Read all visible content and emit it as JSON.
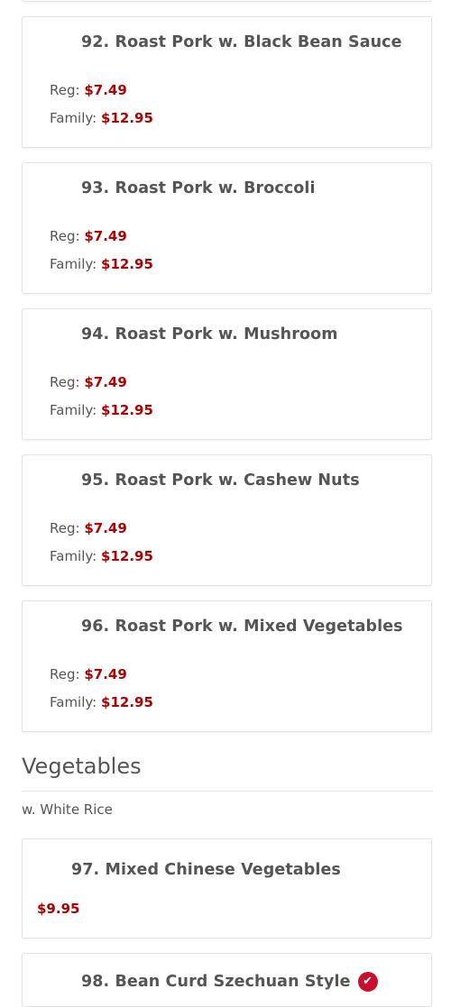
{
  "items": [
    {
      "title": "92. Roast Pork w. Black Bean Sauce",
      "reg_label": "Reg:",
      "reg_price": "$7.49",
      "family_label": "Family:",
      "family_price": "$12.95"
    },
    {
      "title": "93. Roast Pork w. Broccoli",
      "reg_label": "Reg:",
      "reg_price": "$7.49",
      "family_label": "Family:",
      "family_price": "$12.95"
    },
    {
      "title": "94. Roast Pork w. Mushroom",
      "reg_label": "Reg:",
      "reg_price": "$7.49",
      "family_label": "Family:",
      "family_price": "$12.95"
    },
    {
      "title": "95. Roast Pork w. Cashew Nuts",
      "reg_label": "Reg:",
      "reg_price": "$7.49",
      "family_label": "Family:",
      "family_price": "$12.95"
    },
    {
      "title": "96. Roast Pork w. Mixed Vegetables",
      "reg_label": "Reg:",
      "reg_price": "$7.49",
      "family_label": "Family:",
      "family_price": "$12.95"
    }
  ],
  "vegetables": {
    "section_title": "Vegetables",
    "subtitle": "w. White Rice",
    "items": [
      {
        "title": "97. Mixed Chinese Vegetables",
        "price": "$9.95"
      },
      {
        "title": "98. Bean Curd Szechuan Style",
        "spicy": true,
        "spicy_icon": "chili-pepper-icon"
      }
    ]
  },
  "colors": {
    "price": "#b00000",
    "text": "#555555",
    "spicy_badge": "#c8102e"
  }
}
